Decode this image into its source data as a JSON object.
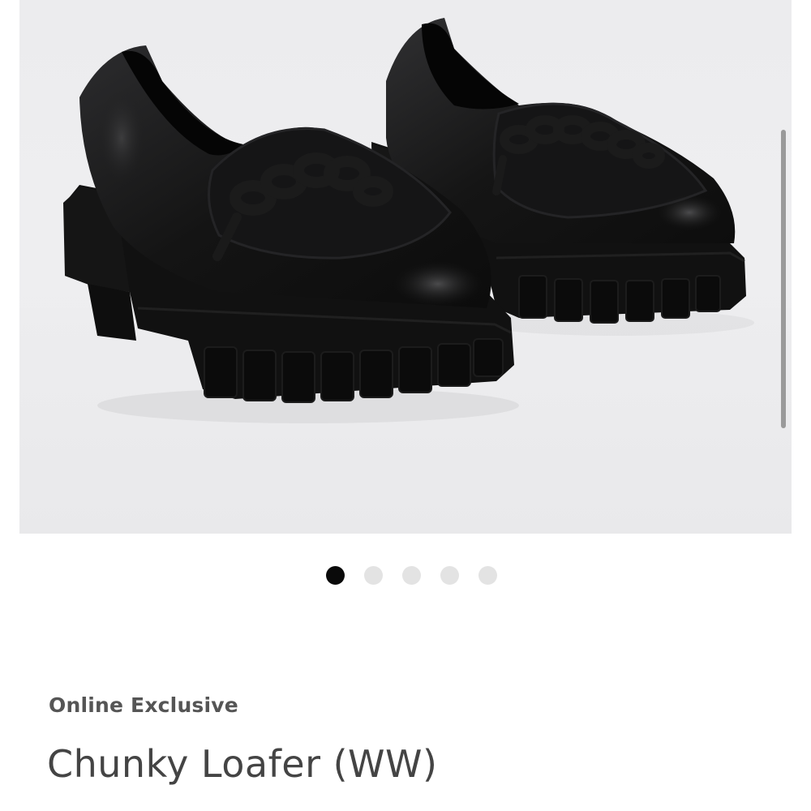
{
  "gallery": {
    "image_alt": "Black chunky lug-sole loafers with chain detail",
    "active_index": 0,
    "dot_count": 5
  },
  "product": {
    "badge": "Online Exclusive",
    "title": "Chunky Loafer (WW)"
  },
  "colors": {
    "active_dot": "#0a0a0a",
    "inactive_dot": "#e3e3e3",
    "badge_text": "#555555",
    "title_text": "#444444"
  }
}
